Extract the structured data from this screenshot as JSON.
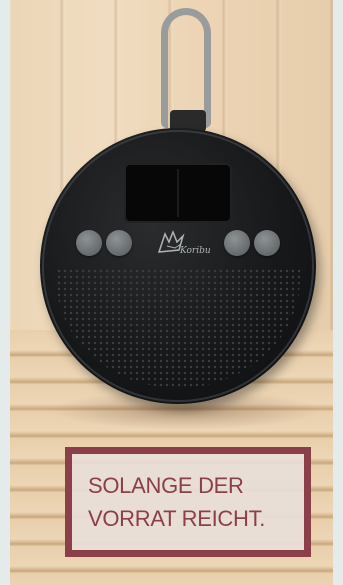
{
  "product": {
    "brand_label": "Koribu",
    "button_icons": [
      "play-pause-icon",
      "volume-down-icon",
      "next-track-icon",
      "volume-up-icon"
    ]
  },
  "notice": {
    "line1": "SOLANGE DER",
    "line2": "VORRAT REICHT."
  },
  "colors": {
    "notice_accent": "#8b4049",
    "speaker_body": "#16181a",
    "strap": "#9a9c9c"
  }
}
